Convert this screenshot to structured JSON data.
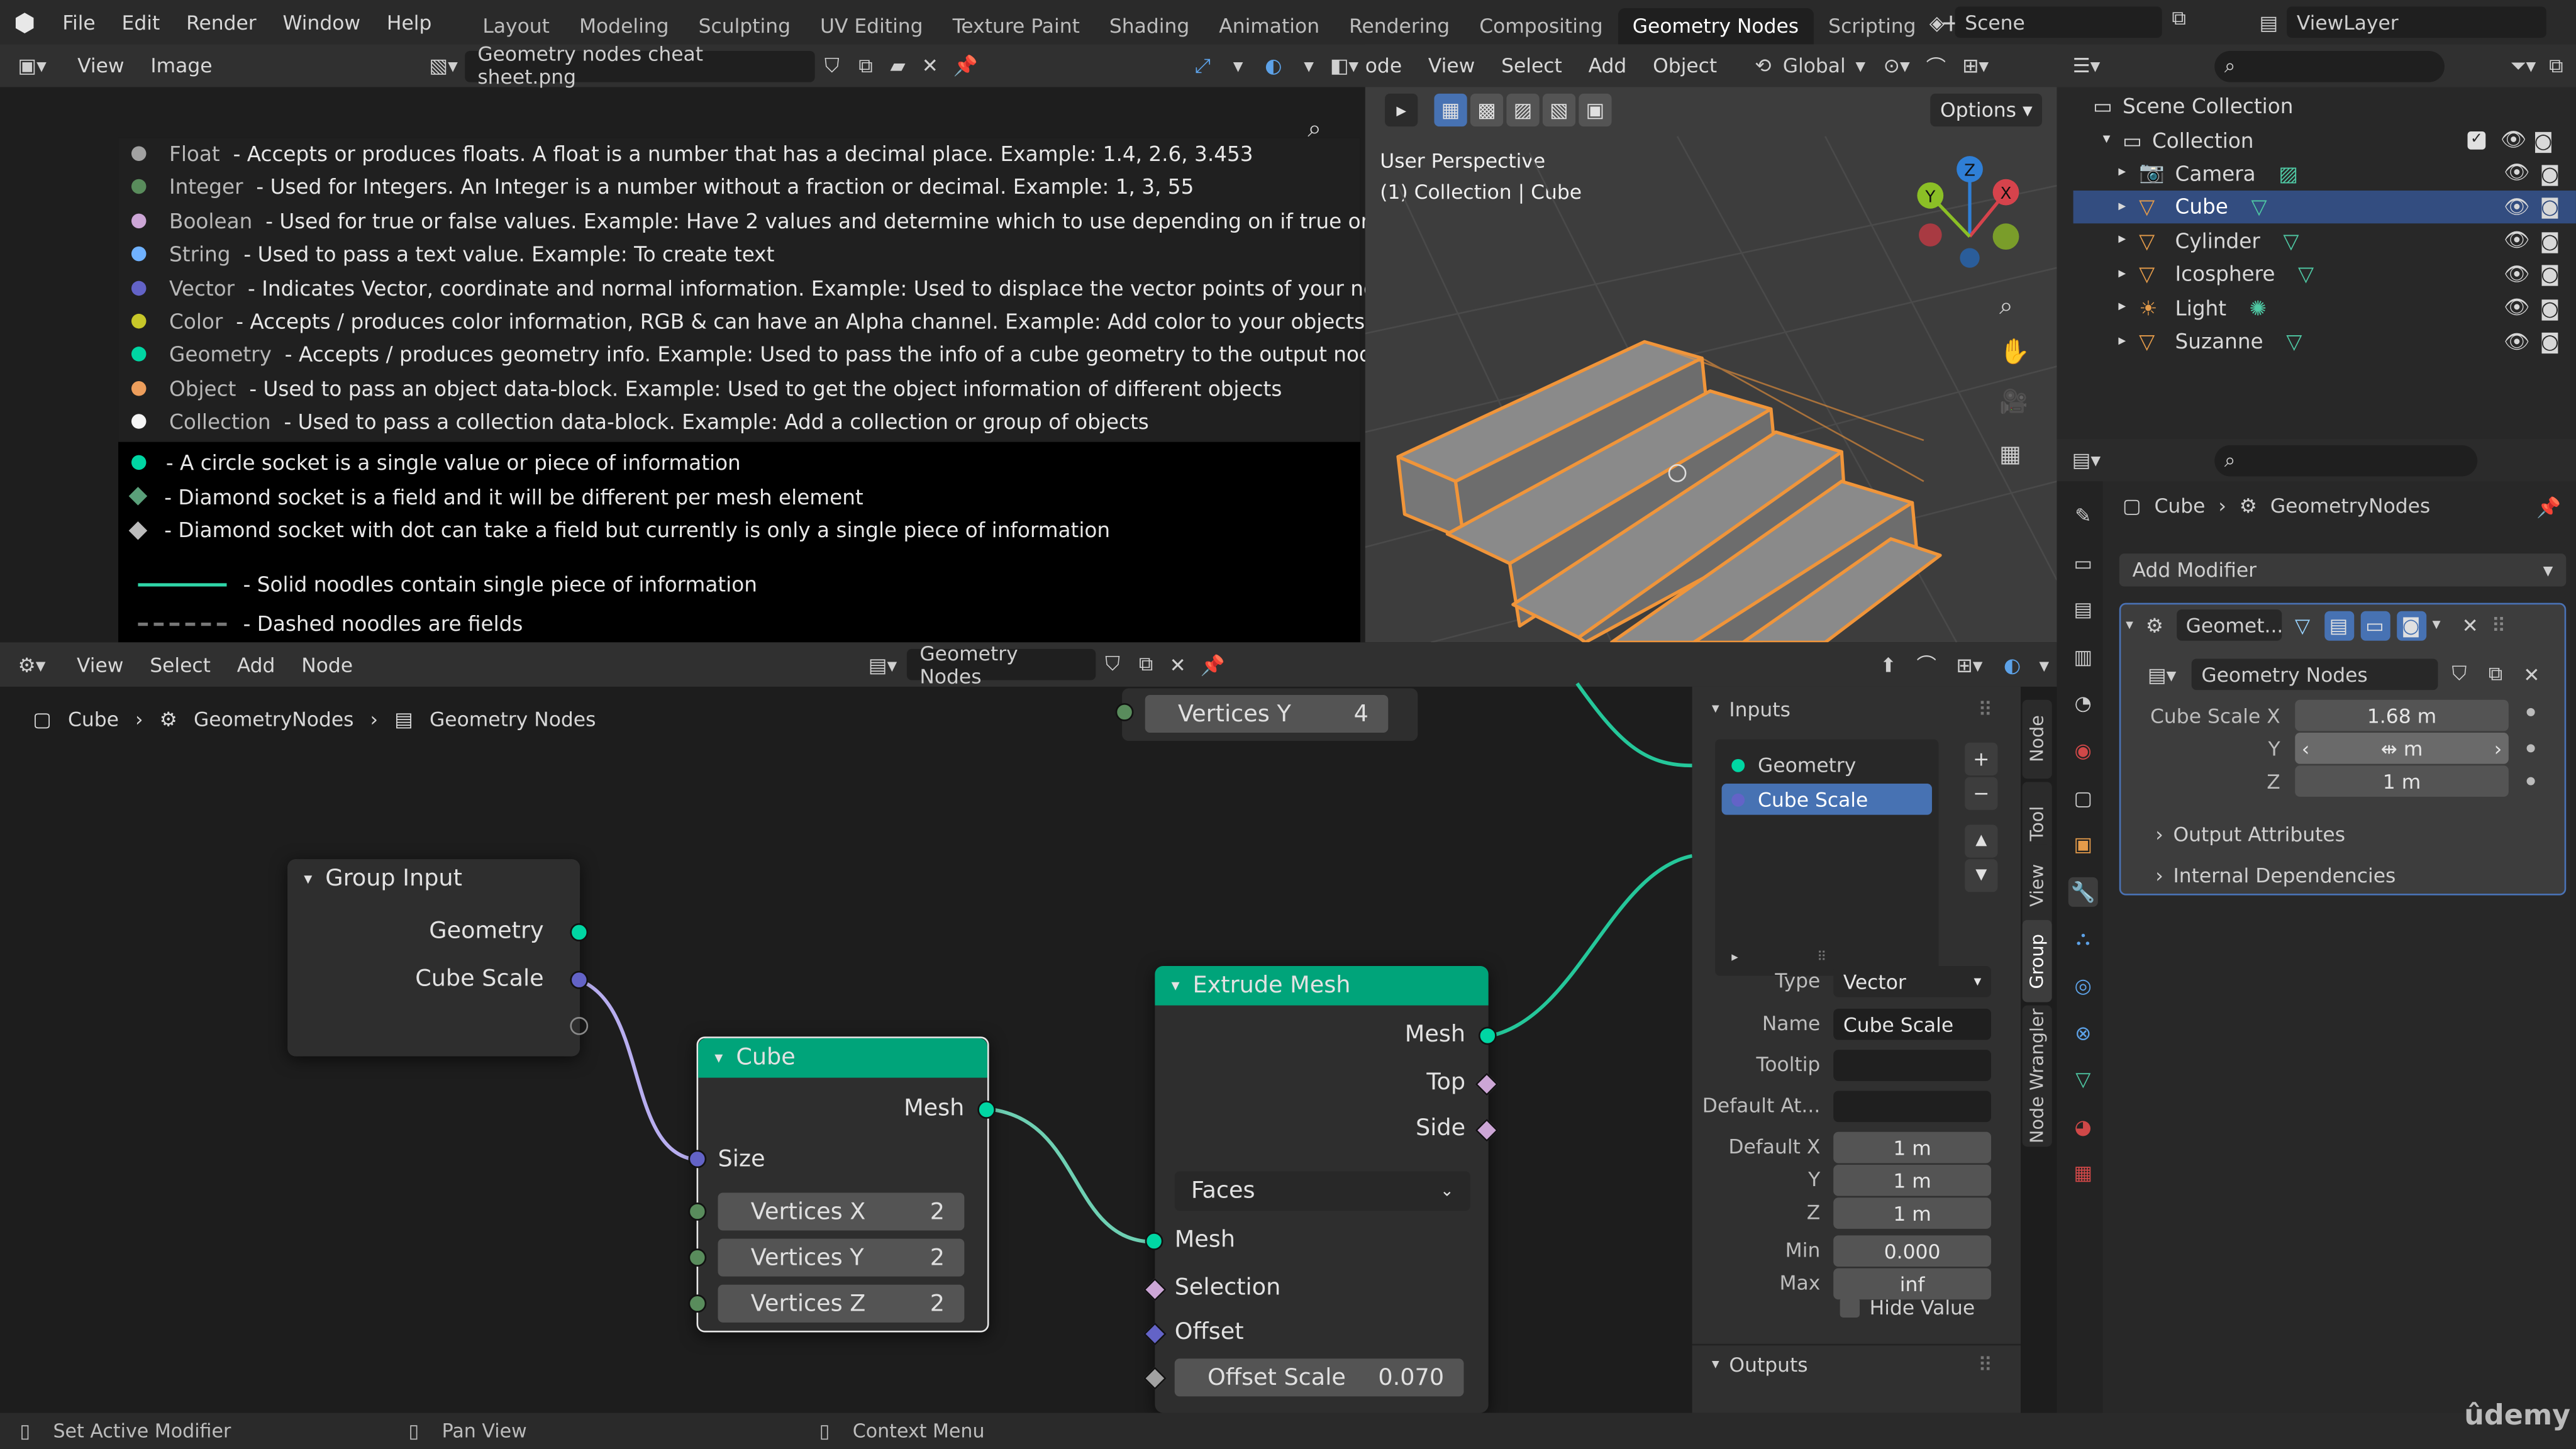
{
  "topbar": {
    "menus": [
      "File",
      "Edit",
      "Render",
      "Window",
      "Help"
    ],
    "workspaces": [
      "Layout",
      "Modeling",
      "Sculpting",
      "UV Editing",
      "Texture Paint",
      "Shading",
      "Animation",
      "Rendering",
      "Compositing",
      "Geometry Nodes",
      "Scripting"
    ],
    "active_workspace": "Geometry Nodes",
    "scene": "Scene",
    "view_layer": "ViewLayer"
  },
  "image_editor": {
    "menus": [
      "View",
      "Image"
    ],
    "filename": "Geometry nodes cheat sheet.png",
    "sheet": {
      "types": [
        {
          "name": "Float",
          "desc": "- Accepts or produces floats. A float is a number that has a decimal place. Example: 1.4, 2.6, 3.453",
          "color": "#a1a1a1"
        },
        {
          "name": "Integer",
          "desc": "- Used for Integers. An Integer is a number without a fraction or decimal. Example: 1, 3, 55",
          "color": "#598c5c"
        },
        {
          "name": "Boolean",
          "desc": "- Used for true or false values. Example: Have 2 values and determine which to use depending on if true or false",
          "color": "#cca6d6"
        },
        {
          "name": "String",
          "desc": "- Used to pass a text value. Example: To create text",
          "color": "#70b2ff"
        },
        {
          "name": "Vector",
          "desc": "- Indicates Vector, coordinate and normal information. Example: Used to displace the vector points of your nodes",
          "color": "#6363c7"
        },
        {
          "name": "Color",
          "desc": "- Accepts / produces color information, RGB & can have an Alpha channel. Example: Add color to your objects",
          "color": "#c7c729"
        },
        {
          "name": "Geometry",
          "desc": "- Accepts / produces geometry info. Example: Used to pass the info of a cube geometry to the output node",
          "color": "#00d6a3"
        },
        {
          "name": "Object",
          "desc": "- Used to pass an object data-block. Example: Used to get the object information of different objects",
          "color": "#ed9e5c"
        },
        {
          "name": "Collection",
          "desc": "- Used to pass a collection data-block. Example: Add a collection or group of objects",
          "color": "#f5f5f5"
        }
      ],
      "sockets": [
        "- A circle socket is a single value or piece of information",
        "- Diamond socket is a field and it will be different per mesh element",
        "- Diamond socket with dot can take a field but currently is only a single piece of information"
      ],
      "noodles": [
        "- Solid noodles contain single piece of information",
        "- Dashed noodles are fields"
      ]
    }
  },
  "viewport": {
    "header_menus": [
      "ode",
      "View",
      "Select",
      "Add",
      "Object"
    ],
    "orientation": "Global",
    "options_label": "Options",
    "perspective": "User Perspective",
    "collection_label": "(1) Collection | Cube"
  },
  "outliner": {
    "root": "Scene Collection",
    "collection": "Collection",
    "items": [
      "Camera",
      "Cube",
      "Cylinder",
      "Icosphere",
      "Light",
      "Suzanne"
    ],
    "selected": "Cube"
  },
  "properties": {
    "breadcrumb_object": "Cube",
    "breadcrumb_modifier": "GeometryNodes",
    "add_modifier": "Add Modifier",
    "modifier_name": "Geomet...",
    "node_group": "Geometry Nodes",
    "cube_scale_label": "Cube Scale X",
    "cube_scale_x": "1.68 m",
    "y_label": "Y",
    "cube_scale_y": "m",
    "z_label": "Z",
    "cube_scale_z": "1 m",
    "output_attributes": "Output Attributes",
    "internal_dependencies": "Internal Dependencies"
  },
  "node_editor": {
    "menus": [
      "View",
      "Select",
      "Add",
      "Node"
    ],
    "tree_name": "Geometry Nodes",
    "breadcrumb": [
      "Cube",
      "GeometryNodes",
      "Geometry Nodes"
    ],
    "floating_field": {
      "label": "Vertices Y",
      "value": "4"
    },
    "group_input": {
      "title": "Group Input",
      "outputs": [
        "Geometry",
        "Cube Scale"
      ]
    },
    "cube_node": {
      "title": "Cube",
      "output": "Mesh",
      "size": "Size",
      "fields": [
        {
          "label": "Vertices X",
          "value": "2"
        },
        {
          "label": "Vertices Y",
          "value": "2"
        },
        {
          "label": "Vertices Z",
          "value": "2"
        }
      ]
    },
    "extrude_node": {
      "title": "Extrude Mesh",
      "outputs": [
        "Mesh",
        "Top",
        "Side"
      ],
      "mode": "Faces",
      "inputs": [
        "Mesh",
        "Selection",
        "Offset"
      ],
      "offset_scale_label": "Offset Scale",
      "offset_scale_value": "0.070"
    }
  },
  "sidebar": {
    "inputs_title": "Inputs",
    "sockets": [
      "Geometry",
      "Cube Scale"
    ],
    "type_label": "Type",
    "type_value": "Vector",
    "name_label": "Name",
    "name_value": "Cube Scale",
    "tooltip_label": "Tooltip",
    "default_at_label": "Default At...",
    "default_x_label": "Default X",
    "default_x": "1 m",
    "y_label": "Y",
    "default_y": "1 m",
    "z_label": "Z",
    "default_z": "1 m",
    "min_label": "Min",
    "min_value": "0.000",
    "max_label": "Max",
    "max_value": "inf",
    "hide_value": "Hide Value",
    "outputs_title": "Outputs",
    "tabs": [
      "Node",
      "Tool",
      "View",
      "Group",
      "Node Wrangler"
    ]
  },
  "statusbar": {
    "items": [
      "Set Active Modifier",
      "Pan View",
      "Context Menu"
    ]
  },
  "watermark": "ûdemy"
}
